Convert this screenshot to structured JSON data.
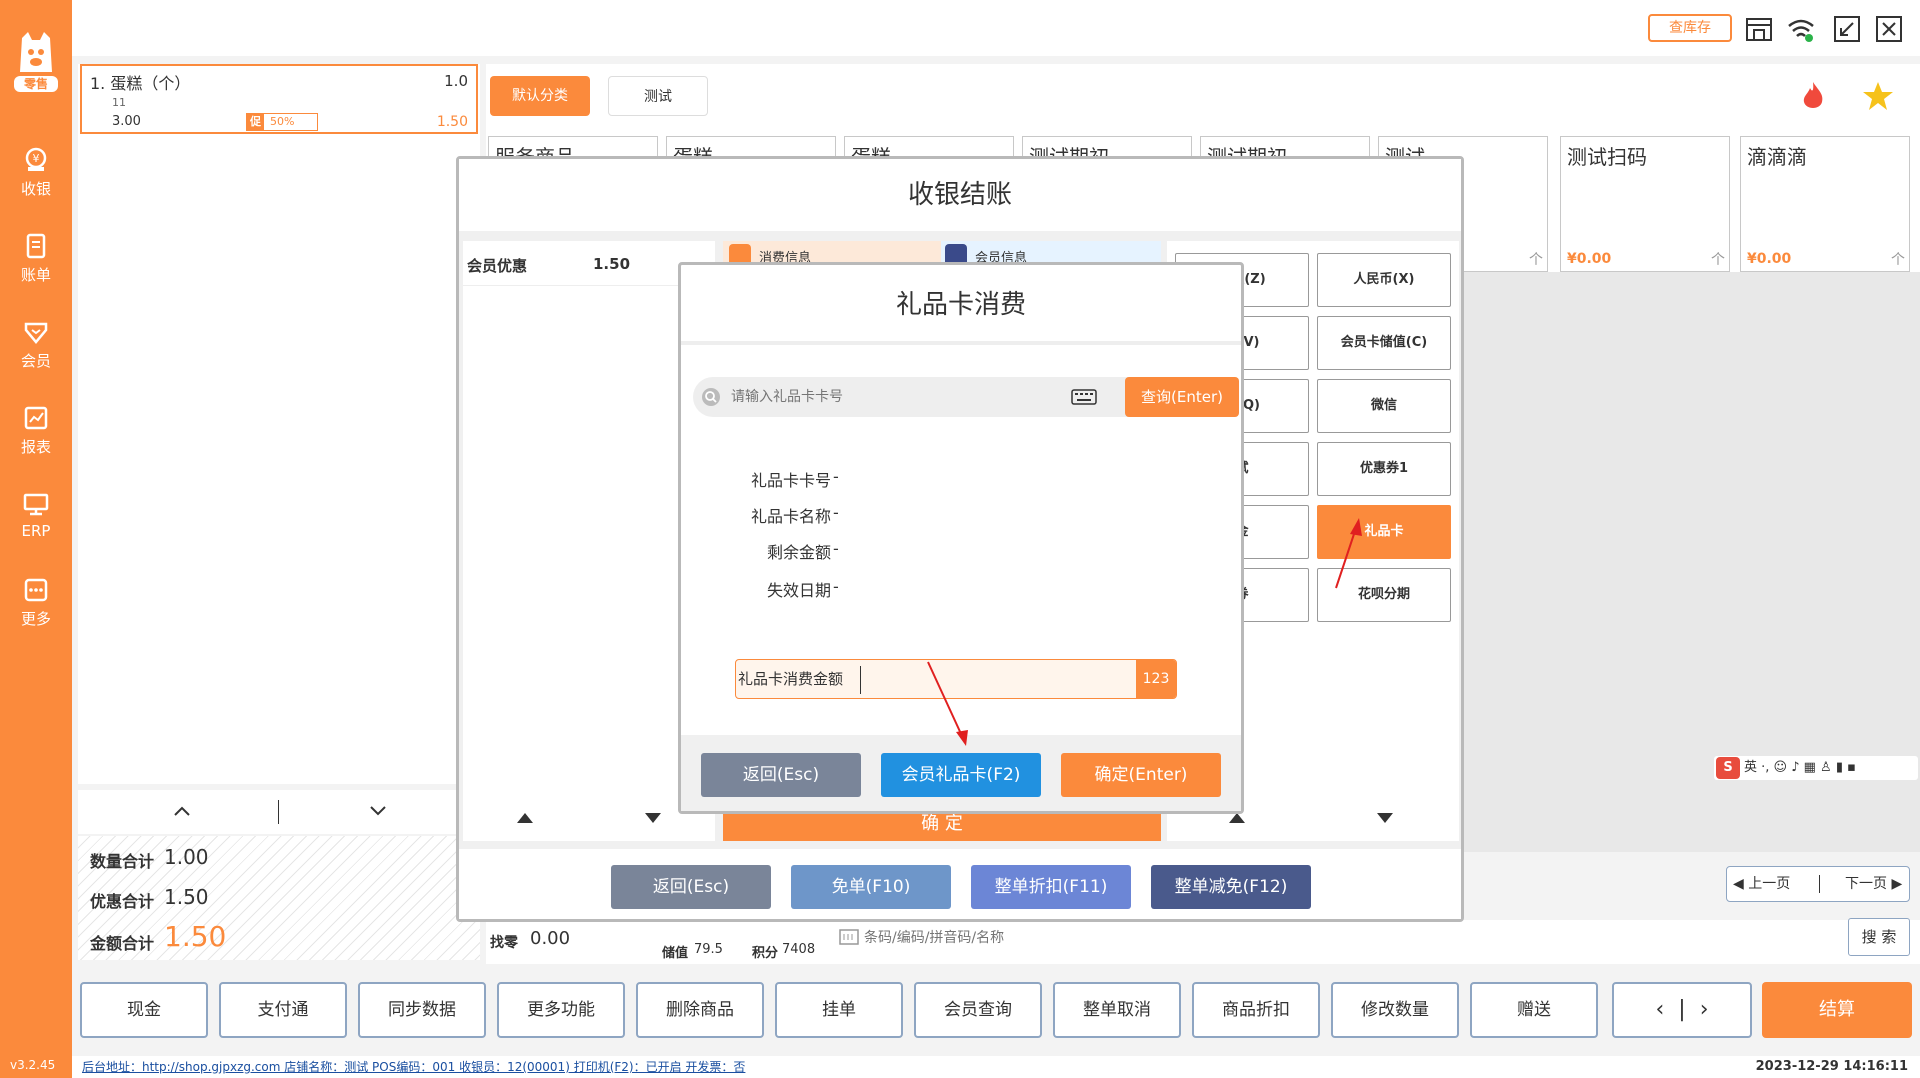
{
  "sidebar": {
    "logo_badge": "零售",
    "items": [
      {
        "label": "收银",
        "icon": "cashier-icon"
      },
      {
        "label": "账单",
        "icon": "bill-icon"
      },
      {
        "label": "会员",
        "icon": "member-icon"
      },
      {
        "label": "报表",
        "icon": "report-icon"
      },
      {
        "label": "ERP",
        "icon": "erp-icon"
      },
      {
        "label": "更多",
        "icon": "more-icon"
      }
    ],
    "version": "v3.2.45"
  },
  "topbar": {
    "stock_button": "查库存"
  },
  "order": {
    "item": {
      "name": "1.  蛋糕（个）",
      "qty": "1.0",
      "code": "11",
      "price": "3.00",
      "promo_tag": "促",
      "promo_value": "50%",
      "subtotal": "1.50"
    },
    "summary": {
      "qty_label": "数量合计",
      "qty_value": "1.00",
      "discount_label": "优惠合计",
      "discount_value": "1.50",
      "total_label": "金额合计",
      "total_value": "1.50"
    }
  },
  "categories": [
    "默认分类",
    "测试"
  ],
  "products": [
    {
      "name": "服务商品"
    },
    {
      "name": "蛋糕"
    },
    {
      "name": "蛋糕"
    },
    {
      "name": "测试期初"
    },
    {
      "name": "测试期初"
    },
    {
      "name": "测试"
    },
    {
      "name": "测试扫码",
      "price": "¥0.00"
    },
    {
      "name": "滴滴滴",
      "price": "¥0.00"
    }
  ],
  "product_pager": {
    "prev": "上一页",
    "next": "下一页"
  },
  "search": {
    "placeholder": "条码/编码/拼音码/名称",
    "button": "搜 索"
  },
  "footer_info": {
    "change_label": "找零",
    "change_value": "0.00",
    "stored_label": "储值",
    "stored_value": "79.5",
    "points_label": "积分",
    "points_value": "7408"
  },
  "funcbar": {
    "buttons": [
      "现金",
      "支付通",
      "同步数据",
      "更多功能",
      "删除商品",
      "挂单",
      "会员查询",
      "整单取消",
      "商品折扣",
      "修改数量",
      "赠送"
    ],
    "checkout": "结算"
  },
  "statusbar": {
    "text": "后台地址：http://shop.gjpxzg.com  店铺名称：测试  POS编码：001  收银员：12(00001)  打印机(F2)：已开启  开发票：否",
    "datetime": "2023-12-29 14:16:11"
  },
  "settle": {
    "title": "收银结账",
    "member_discount_label": "会员优惠",
    "member_discount_value": "1.50",
    "tab_consume": "消费信息",
    "tab_member": "会员信息",
    "confirm_bg": "确    定",
    "payment_methods": [
      "储值(Z)",
      "人民币(X)",
      "扣(V)",
      "会员卡储值(C)",
      "宝(Q)",
      "微信",
      "试",
      "优惠券1",
      "金",
      "礼品卡",
      "券",
      "花呗分期"
    ],
    "bottom_buttons": [
      "返回(Esc)",
      "免单(F10)",
      "整单折扣(F11)",
      "整单减免(F12)"
    ]
  },
  "gift": {
    "title": "礼品卡消费",
    "search_placeholder": "请输入礼品卡卡号",
    "query_button": "查询(Enter)",
    "fields": [
      {
        "label": "礼品卡卡号",
        "value": "-"
      },
      {
        "label": "礼品卡名称",
        "value": "-"
      },
      {
        "label": "剩余金额",
        "value": "-"
      },
      {
        "label": "失效日期",
        "value": "-"
      }
    ],
    "amount_label": "礼品卡消费金额",
    "keypad_label": "123",
    "buttons": {
      "back": "返回(Esc)",
      "member_card": "会员礼品卡(F2)",
      "confirm": "确定(Enter)"
    }
  },
  "colors": {
    "accent": "#fb8a3c",
    "blue": "#2191e0",
    "slate": "#7a8599"
  }
}
